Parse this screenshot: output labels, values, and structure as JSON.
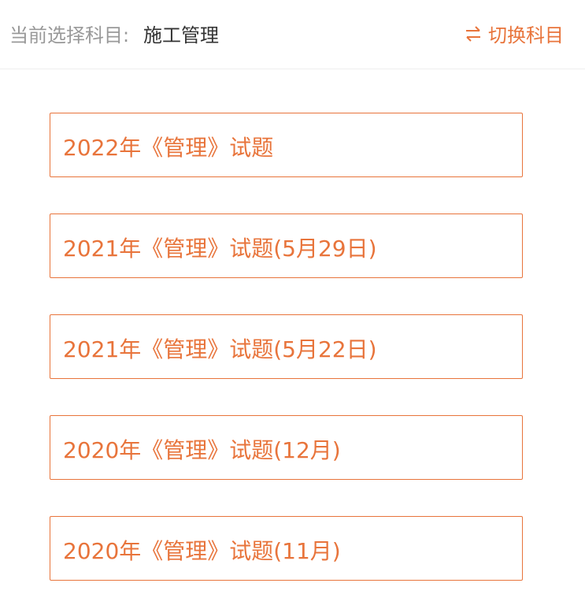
{
  "header": {
    "subject_label": "当前选择科目:",
    "subject_value": "施工管理",
    "switch_label": "切换科目",
    "switch_icon": "swap-arrows-icon",
    "accent_color": "#e8743b"
  },
  "exams": [
    {
      "title": "2022年《管理》试题"
    },
    {
      "title": "2021年《管理》试题(5月29日)"
    },
    {
      "title": "2021年《管理》试题(5月22日)"
    },
    {
      "title": "2020年《管理》试题(12月)"
    },
    {
      "title": "2020年《管理》试题(11月)"
    }
  ]
}
